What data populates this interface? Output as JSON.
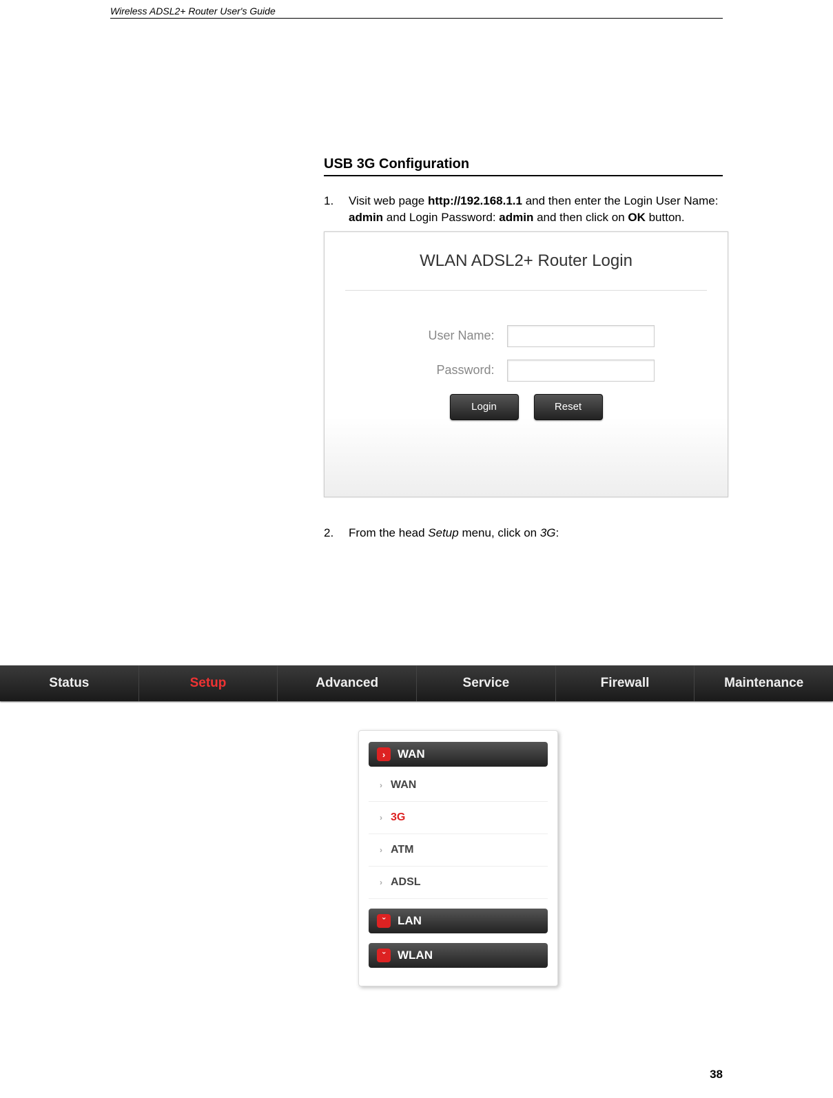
{
  "header": {
    "title": "Wireless ADSL2+ Router User's Guide"
  },
  "section": {
    "title": "USB 3G Configuration"
  },
  "steps": {
    "one_num": "1.",
    "one_prefix": "Visit web page ",
    "one_url": "http://192.168.1.1",
    "one_mid1": " and then enter the Login User Name: ",
    "one_user": "admin",
    "one_mid2": " and Login Password: ",
    "one_pass": "admin",
    "one_mid3": " and then click on ",
    "one_ok": "OK",
    "one_end": " button.",
    "two_num": "2.",
    "two_prefix": "From the head ",
    "two_setup": "Setup",
    "two_mid": " menu, click on ",
    "two_3g": "3G",
    "two_end": ":"
  },
  "login": {
    "title": "WLAN ADSL2+ Router Login",
    "user_label": "User Name:",
    "pass_label": "Password:",
    "login_btn": "Login",
    "reset_btn": "Reset"
  },
  "nav": {
    "status": "Status",
    "setup": "Setup",
    "advanced": "Advanced",
    "service": "Service",
    "firewall": "Firewall",
    "maintenance": "Maintenance"
  },
  "menu": {
    "wan_header": "WAN",
    "wan": "WAN",
    "3g": "3G",
    "atm": "ATM",
    "adsl": "ADSL",
    "lan_header": "LAN",
    "wlan_header": "WLAN"
  },
  "footer": {
    "page": "38"
  }
}
